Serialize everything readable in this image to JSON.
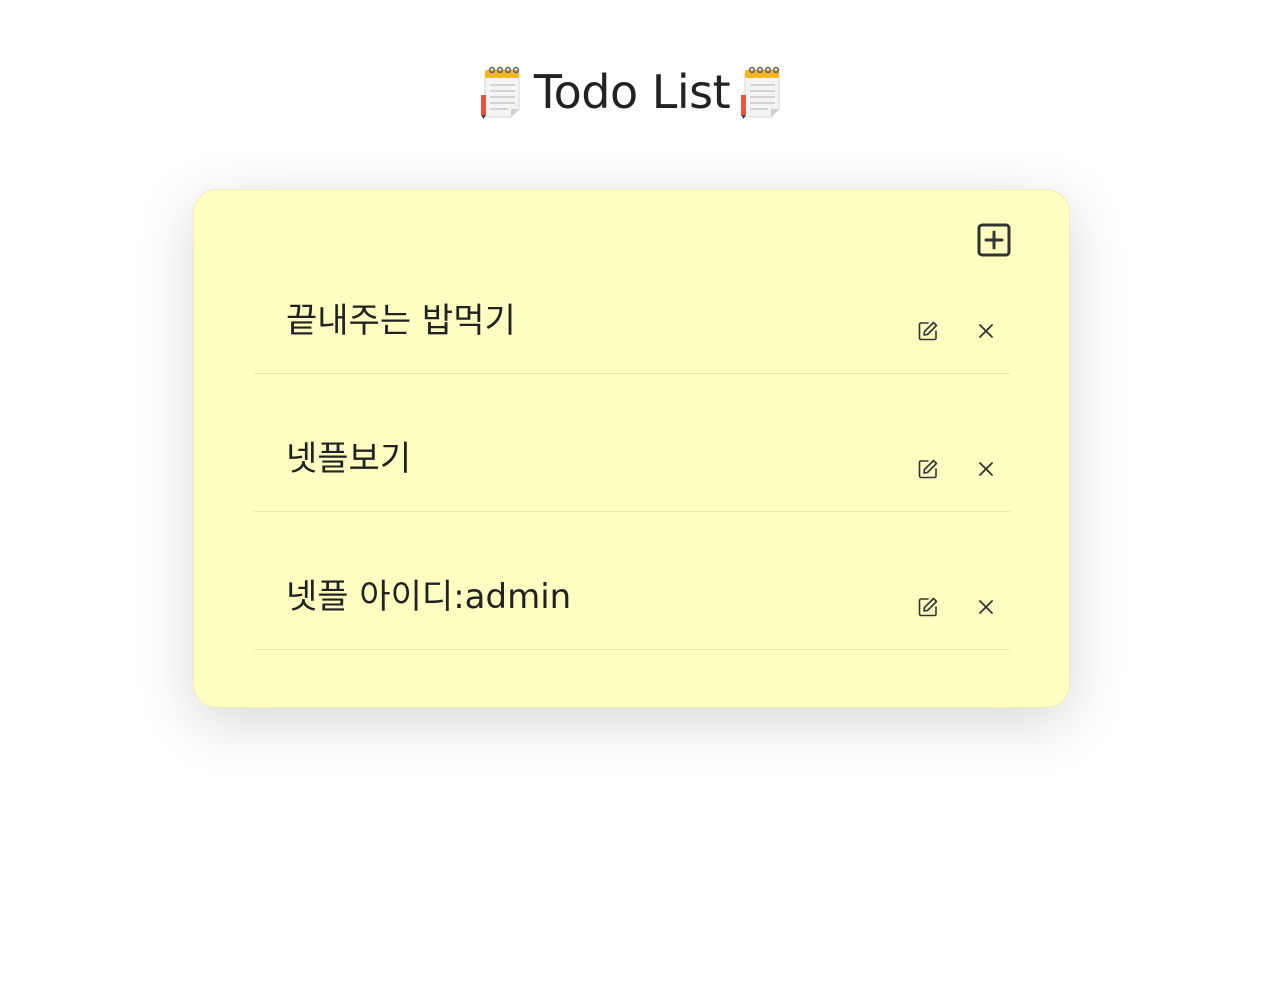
{
  "header": {
    "title": "Todo List",
    "left_icon": "notepad-icon",
    "right_icon": "notepad-icon"
  },
  "toolbar": {
    "add_icon": "plus-square-icon"
  },
  "todos": [
    {
      "text": "끝내주는 밥먹기",
      "edit_icon": "edit-icon",
      "delete_icon": "close-icon"
    },
    {
      "text": "넷플보기",
      "edit_icon": "edit-icon",
      "delete_icon": "close-icon"
    },
    {
      "text": "넷플 아이디:admin",
      "edit_icon": "edit-icon",
      "delete_icon": "close-icon"
    }
  ],
  "colors": {
    "card_background": "#ffffc2",
    "text": "#222222",
    "notepad_binding": "#f5b51c",
    "pencil": "#e8543e"
  }
}
